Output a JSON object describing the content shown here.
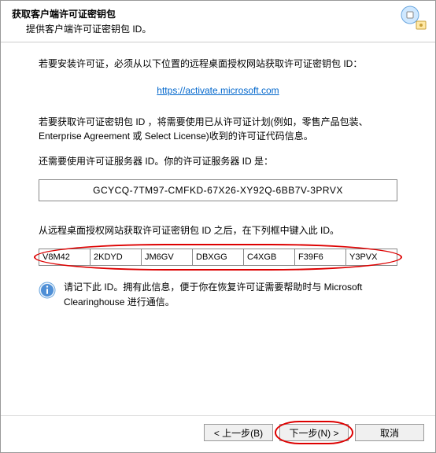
{
  "header": {
    "title": "获取客户端许可证密钥包",
    "subtitle": "提供客户端许可证密钥包 ID。"
  },
  "body": {
    "intro": "若要安装许可证，必须从以下位置的远程桌面授权网站获取许可证密钥包 ID：",
    "link_text": "https://activate.microsoft.com",
    "para2": "若要获取许可证密钥包 ID ，将需要使用已从许可证计划(例如，零售产品包装、Enterprise Agreement 或 Select License)收到的许可证代码信息。",
    "para3": "还需要使用许可证服务器 ID。你的许可证服务器 ID 是：",
    "server_id": "GCYCQ-7TM97-CMFKD-67X26-XY92Q-6BB7V-3PRVX",
    "para4": "从远程桌面授权网站获取许可证密钥包 ID 之后，在下列框中键入此 ID。",
    "id_values": [
      "V8M42",
      "2KDYD",
      "JM6GV",
      "DBXGG",
      "C4XGB",
      "F39F6",
      "Y3PVX"
    ],
    "info_text": "请记下此 ID。拥有此信息，便于你在恢复许可证需要帮助时与 Microsoft Clearinghouse 进行通信。"
  },
  "footer": {
    "back": "< 上一步(B)",
    "next": "下一步(N) >",
    "cancel": "取消"
  }
}
